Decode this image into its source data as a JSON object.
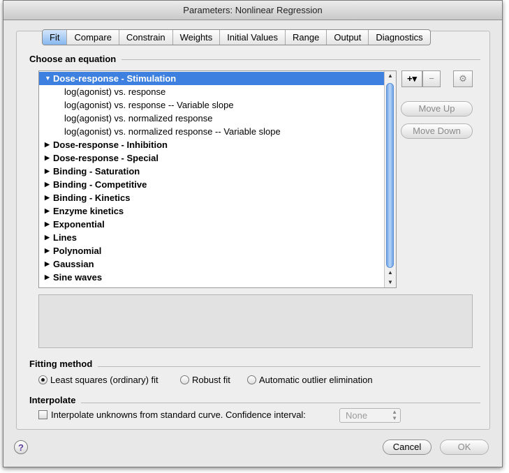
{
  "window": {
    "title": "Parameters: Nonlinear Regression"
  },
  "tabs": [
    "Fit",
    "Compare",
    "Constrain",
    "Weights",
    "Initial Values",
    "Range",
    "Output",
    "Diagnostics"
  ],
  "active_tab": "Fit",
  "equation_section": {
    "label": "Choose an equation",
    "items": [
      {
        "label": "Dose-response - Stimulation",
        "level": 0,
        "expanded": true,
        "selected": true
      },
      {
        "label": "log(agonist) vs. response",
        "level": 1
      },
      {
        "label": "log(agonist) vs. response -- Variable slope",
        "level": 1
      },
      {
        "label": "log(agonist) vs. normalized response",
        "level": 1
      },
      {
        "label": "log(agonist) vs. normalized response -- Variable slope",
        "level": 1
      },
      {
        "label": "Dose-response - Inhibition",
        "level": 0
      },
      {
        "label": "Dose-response - Special",
        "level": 0
      },
      {
        "label": "Binding - Saturation",
        "level": 0
      },
      {
        "label": "Binding - Competitive",
        "level": 0
      },
      {
        "label": "Binding - Kinetics",
        "level": 0
      },
      {
        "label": "Enzyme kinetics",
        "level": 0
      },
      {
        "label": "Exponential",
        "level": 0
      },
      {
        "label": "Lines",
        "level": 0
      },
      {
        "label": "Polynomial",
        "level": 0
      },
      {
        "label": "Gaussian",
        "level": 0
      },
      {
        "label": "Sine waves",
        "level": 0
      }
    ],
    "add_label": "+▾",
    "remove_label": "−",
    "gear_icon": "gear-icon",
    "move_up_label": "Move Up",
    "move_down_label": "Move Down"
  },
  "fitting_method": {
    "label": "Fitting method",
    "options": [
      "Least squares (ordinary) fit",
      "Robust fit",
      "Automatic outlier elimination"
    ],
    "selected": 0
  },
  "interpolate": {
    "label": "Interpolate",
    "checkbox_label": "Interpolate unknowns from standard curve. Confidence interval:",
    "checked": false,
    "ci_value": "None"
  },
  "footer": {
    "help_label": "?",
    "cancel_label": "Cancel",
    "ok_label": "OK"
  },
  "colors": {
    "selection": "#3d80df",
    "active_tab": "#86b7ef",
    "help": "#5d3f9d"
  }
}
